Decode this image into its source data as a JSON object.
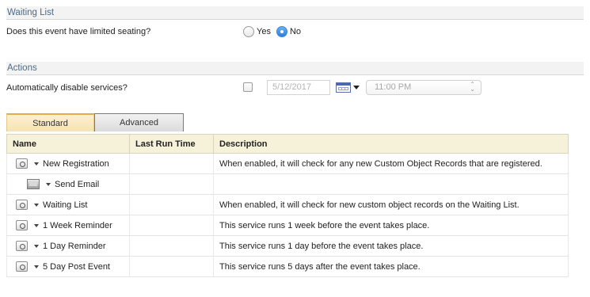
{
  "waiting_list": {
    "title": "Waiting List",
    "question": "Does this event have limited seating?",
    "options": [
      {
        "label": "Yes",
        "checked": false
      },
      {
        "label": "No",
        "checked": true
      }
    ]
  },
  "actions": {
    "title": "Actions",
    "disable_label": "Automatically disable services?",
    "disable_checked": false,
    "date_value": "5/12/2017",
    "time_value": "11:00 PM"
  },
  "tabs": [
    {
      "label": "Standard",
      "active": true
    },
    {
      "label": "Advanced",
      "active": false
    }
  ],
  "table": {
    "columns": [
      "Name",
      "Last Run Time",
      "Description"
    ],
    "rows": [
      {
        "name": "New Registration",
        "icon": "service-icon",
        "indent": false,
        "last_run": "",
        "description": "When enabled, it will check for any new Custom Object Records that are registered."
      },
      {
        "name": "Send Email",
        "icon": "email-icon",
        "indent": true,
        "last_run": "",
        "description": ""
      },
      {
        "name": "Waiting List",
        "icon": "service-icon",
        "indent": false,
        "last_run": "",
        "description": "When enabled, it will check for new custom object records on the Waiting List."
      },
      {
        "name": "1 Week Reminder",
        "icon": "service-icon",
        "indent": false,
        "last_run": "",
        "description": "This service runs 1 week before the event takes place."
      },
      {
        "name": "1 Day Reminder",
        "icon": "service-icon",
        "indent": false,
        "last_run": "",
        "description": "This service runs 1 day before the event takes place."
      },
      {
        "name": "5 Day Post Event",
        "icon": "service-icon",
        "indent": false,
        "last_run": "",
        "description": "This service runs 5 days after the event takes place."
      }
    ]
  }
}
